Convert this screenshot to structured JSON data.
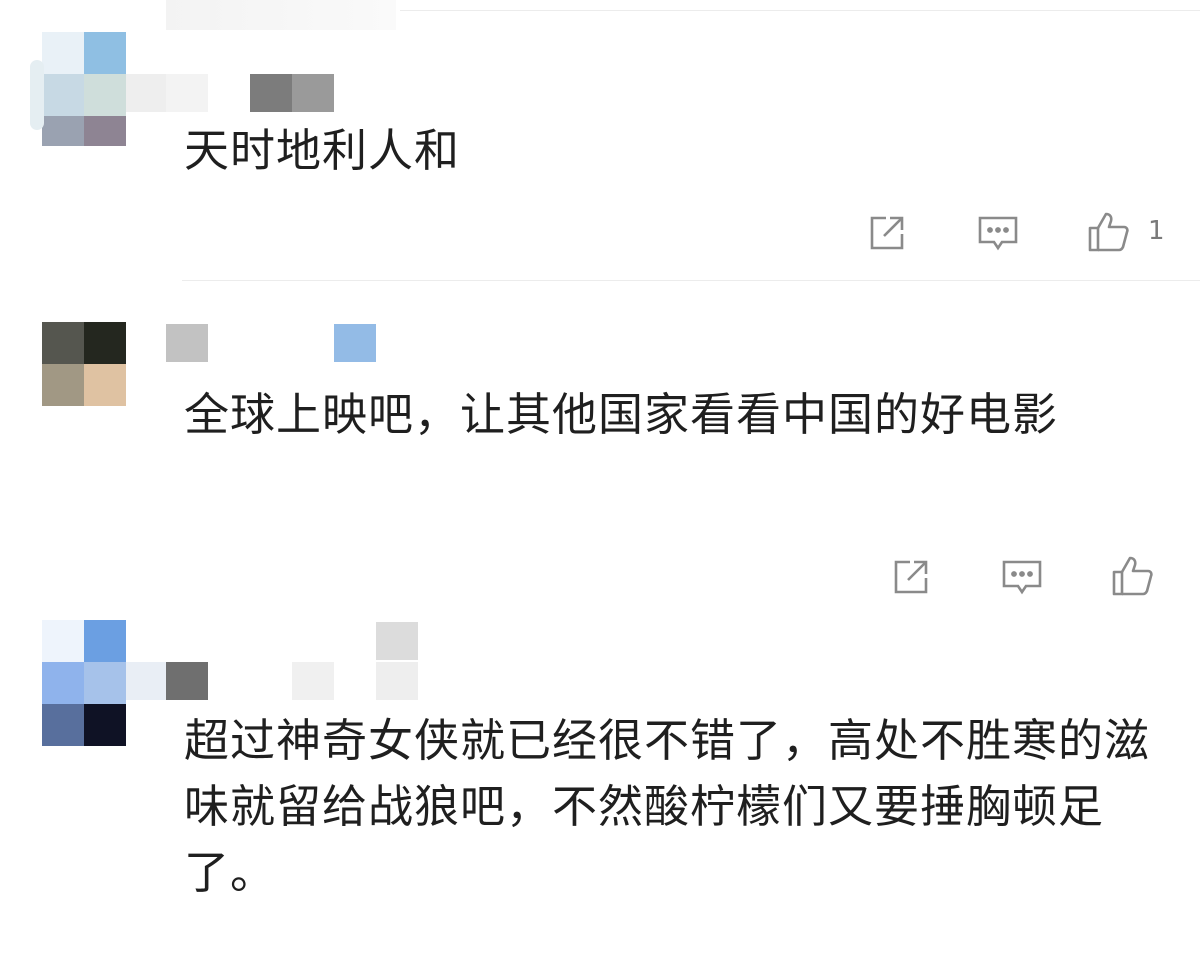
{
  "comments": [
    {
      "text": "天时地利人和",
      "actions": {
        "share_icon": "share-icon",
        "reply_icon": "reply-icon",
        "like_icon": "thumbs-up-icon",
        "like_count": "1"
      }
    },
    {
      "text": "全球上映吧，让其他国家看看中国的好电影",
      "actions": {
        "share_icon": "share-icon",
        "reply_icon": "reply-icon",
        "like_icon": "thumbs-up-icon",
        "like_count": ""
      }
    },
    {
      "text": "超过神奇女侠就已经很不错了，高处不胜寒的滋味就留给战狼吧，不然酸柠檬们又要捶胸顿足了。"
    }
  ],
  "colors": {
    "icon": "#8a8a8a",
    "divider": "#ececec",
    "text": "#1f1f1f"
  }
}
